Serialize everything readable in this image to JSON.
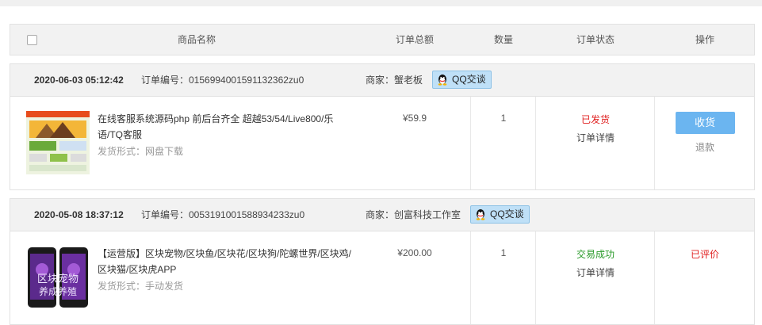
{
  "table_header": {
    "product": "商品名称",
    "total": "订单总额",
    "quantity": "数量",
    "status": "订单状态",
    "actions": "操作"
  },
  "orders": [
    {
      "date": "2020-06-03 05:12:42",
      "order_no": "订单编号：0156994001591132362zu0",
      "seller": "商家：蟹老板",
      "qq_label": "QQ交谈",
      "product_name": "在线客服系统源码php 前后台齐全 超越53/54/Live800/乐语/TQ客服",
      "shipping": "发货形式：网盘下载",
      "price": "¥59.9",
      "quantity": "1",
      "status": "已发货",
      "status_color": "#e02020",
      "detail": "订单详情",
      "action_button": "收货",
      "action_link": "退款"
    },
    {
      "date": "2020-05-08 18:37:12",
      "order_no": "订单编号：0053191001588934233zu0",
      "seller": "商家：创富科技工作室",
      "qq_label": "QQ交谈",
      "product_name": "【运营版】区块宠物/区块鱼/区块花/区块狗/陀螺世界/区块鸡/区块猫/区块虎APP",
      "shipping": "发货形式：手动发货",
      "price": "¥200.00",
      "quantity": "1",
      "status": "交易成功",
      "status_color": "#2a9a2a",
      "detail": "订单详情",
      "action_text": "已评价",
      "action_color": "#e02020",
      "thumb_text": "区块宠物 养成养殖"
    }
  ]
}
